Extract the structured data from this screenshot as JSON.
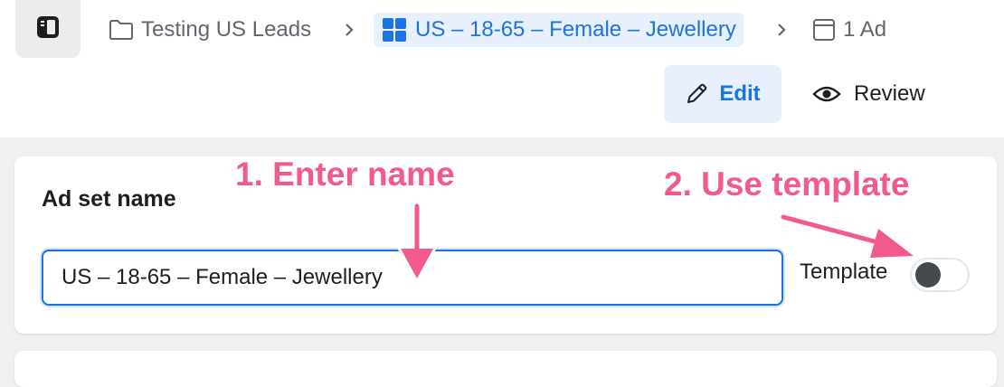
{
  "breadcrumb": {
    "campaign": "Testing US Leads",
    "ad_set": "US – 18-65 – Female – Jewellery",
    "ad": "1 Ad"
  },
  "actions": {
    "edit_label": "Edit",
    "review_label": "Review"
  },
  "ad_set_card": {
    "title": "Ad set name",
    "name_value": "US – 18-65 – Female – Jewellery",
    "template_label": "Template",
    "template_enabled": false
  },
  "annotations": {
    "step1": "1. Enter name",
    "step2": "2. Use template"
  },
  "colors": {
    "accent": "#1b74e4",
    "accent_bg": "#e7f0fc",
    "annotation": "#f2598f"
  }
}
